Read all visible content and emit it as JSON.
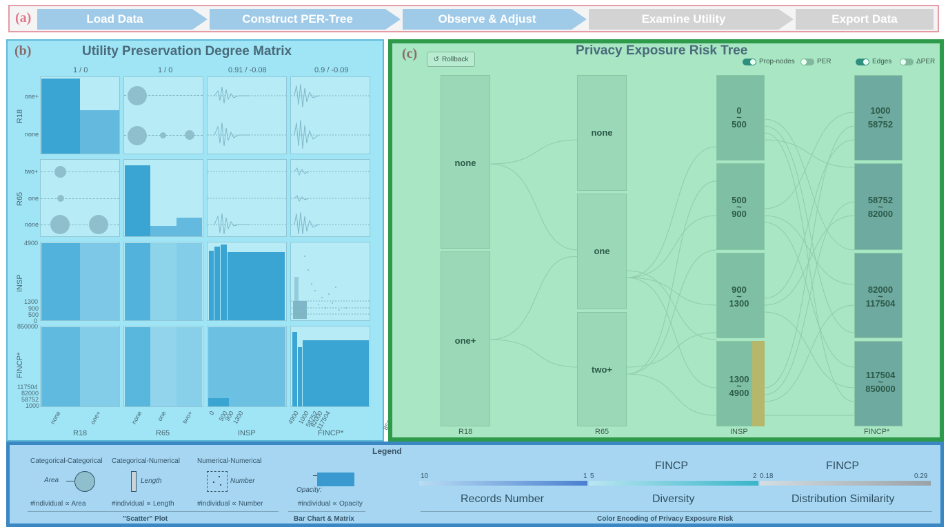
{
  "workflow": {
    "tag": "(a)",
    "steps": [
      {
        "label": "Load Data",
        "state": "active"
      },
      {
        "label": "Construct PER-Tree",
        "state": "active"
      },
      {
        "label": "Observe & Adjust",
        "state": "active"
      },
      {
        "label": "Examine Utility",
        "state": "inactive"
      },
      {
        "label": "Export Data",
        "state": "inactive"
      }
    ]
  },
  "matrix_panel": {
    "tag": "(b)",
    "title": "Utility Preservation Degree Matrix",
    "col_headers": [
      "1 / 0",
      "1 / 0",
      "0.91 / -0.08",
      "0.9 / -0.09"
    ],
    "row_labels": [
      "R18",
      "R65",
      "INSP",
      "FINCP*"
    ],
    "col_labels": [
      "R18",
      "R65",
      "INSP",
      "FINCP*"
    ],
    "r18_ticks": [
      "one+",
      "none"
    ],
    "r65_ticks": [
      "two+",
      "one",
      "none"
    ],
    "insp_ticks": [
      "4900",
      "1300",
      "900",
      "500",
      "0"
    ],
    "fincp_ticks": [
      "850000",
      "117504",
      "82000",
      "58752",
      "1000"
    ],
    "x_r18": [
      "none",
      "one+"
    ],
    "x_r65": [
      "none",
      "one",
      "two+"
    ],
    "x_insp": [
      "0",
      "500",
      "900",
      "1300",
      "4900"
    ],
    "x_fincp": [
      "1000",
      "58752",
      "82000",
      "117504",
      "850000"
    ]
  },
  "tree_panel": {
    "tag": "(c)",
    "title": "Privacy Exposure Risk Tree",
    "rollback_label": "Rollback",
    "toggles": [
      {
        "label": "Prop-nodes",
        "on": true
      },
      {
        "label": "PER",
        "on": false
      },
      {
        "label": "Edges",
        "on": true
      },
      {
        "label": "ΔPER",
        "on": false
      }
    ],
    "r18_nodes": [
      "none",
      "one+"
    ],
    "r65_nodes": [
      "none",
      "one",
      "two+"
    ],
    "insp_nodes": [
      {
        "low": "0",
        "high": "500"
      },
      {
        "low": "500",
        "high": "900"
      },
      {
        "low": "900",
        "high": "1300"
      },
      {
        "low": "1300",
        "high": "4900"
      }
    ],
    "fincp_nodes": [
      {
        "low": "1000",
        "high": "58752"
      },
      {
        "low": "58752",
        "high": "82000"
      },
      {
        "low": "82000",
        "high": "117504"
      },
      {
        "low": "117504",
        "high": "850000"
      }
    ],
    "range_sep": "~",
    "axis_labels": [
      "R18",
      "R65",
      "INSP",
      "FINCP*"
    ]
  },
  "legend": {
    "title": "Legend",
    "cat_cat": "Categorical-Categorical",
    "cat_num": "Categorical-Numerical",
    "num_num": "Numerical-Numerical",
    "area": "Area",
    "length": "Length",
    "number": "Number",
    "opacity": "Opacity:",
    "prop_area": "#individual ∝ Area",
    "prop_length": "#individual ∝ Length",
    "prop_number": "#individual ∝ Number",
    "prop_opacity": "#individual ∝ Opacity",
    "scatter_caption": "\"Scatter\" Plot",
    "bar_caption": "Bar Chart & Matrix",
    "records_min": "10",
    "records_max": "1",
    "div_min": "5",
    "div_max": "2",
    "sim_min": "0.18",
    "sim_max": "0.29",
    "div_header": "FINCP",
    "sim_header": "FINCP",
    "records_label": "Records Number",
    "div_label": "Diversity",
    "sim_label": "Distribution Similarity",
    "color_caption": "Color Encoding of Privacy Exposure Risk",
    "colors": {
      "records_end": "#4a7fd0",
      "diversity_end": "#39b5c9",
      "similarity_end": "#9aa2a8"
    }
  }
}
